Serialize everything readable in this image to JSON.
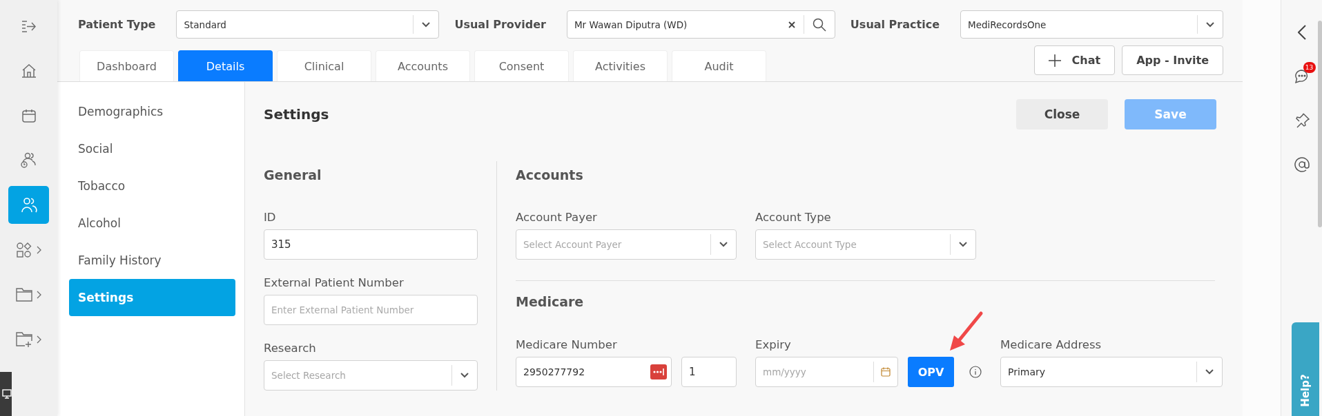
{
  "nav_rail": {
    "items": [
      {
        "kind": "expand",
        "selected": false,
        "submenu": false
      },
      {
        "kind": "home",
        "selected": false,
        "submenu": false
      },
      {
        "kind": "calendar",
        "selected": false,
        "submenu": false
      },
      {
        "kind": "waiting",
        "selected": false,
        "submenu": false
      },
      {
        "kind": "patients",
        "selected": true,
        "submenu": false
      },
      {
        "kind": "shapes",
        "selected": false,
        "submenu": true
      },
      {
        "kind": "folder",
        "selected": false,
        "submenu": true
      },
      {
        "kind": "folder-add",
        "selected": false,
        "submenu": true
      }
    ]
  },
  "header": {
    "fields": [
      {
        "label": "Patient Type",
        "value": "Standard",
        "kind": "select"
      },
      {
        "label": "Usual Provider",
        "value": "Mr Wawan Diputra (WD)",
        "kind": "search"
      },
      {
        "label": "Usual Practice",
        "value": "MediRecordsOne",
        "kind": "select"
      }
    ]
  },
  "tabs": [
    {
      "label": "Dashboard",
      "selected": false
    },
    {
      "label": "Details",
      "selected": true
    },
    {
      "label": "Clinical",
      "selected": false
    },
    {
      "label": "Accounts",
      "selected": false
    },
    {
      "label": "Consent",
      "selected": false
    },
    {
      "label": "Activities",
      "selected": false
    },
    {
      "label": "Audit",
      "selected": false
    }
  ],
  "header_buttons": [
    {
      "label": "Chat",
      "kind": "add"
    },
    {
      "label": "App - Invite",
      "kind": "plain"
    }
  ],
  "submenu": [
    {
      "label": "Demographics",
      "selected": false
    },
    {
      "label": "Social",
      "selected": false
    },
    {
      "label": "Tobacco",
      "selected": false
    },
    {
      "label": "Alcohol",
      "selected": false
    },
    {
      "label": "Family History",
      "selected": false
    },
    {
      "label": "Settings",
      "selected": true
    }
  ],
  "page": {
    "title": "Settings",
    "buttons": [
      {
        "label": "Close",
        "kind": "secondary",
        "disabled": false
      },
      {
        "label": "Save",
        "kind": "primary",
        "disabled": true
      }
    ]
  },
  "general": {
    "title": "General",
    "fields": [
      {
        "label": "ID",
        "value": "315",
        "kind": "text"
      },
      {
        "label": "External Patient Number",
        "placeholder": "Enter External Patient Number",
        "kind": "text"
      },
      {
        "label": "Research",
        "placeholder": "Select Research",
        "kind": "select"
      }
    ]
  },
  "accounts": {
    "title": "Accounts",
    "fields": [
      {
        "label": "Account Payer",
        "placeholder": "Select Account Payer"
      },
      {
        "label": "Account Type",
        "placeholder": "Select Account Type"
      }
    ]
  },
  "medicare": {
    "title": "Medicare",
    "number": {
      "label": "Medicare Number",
      "value": "2950277792",
      "irn": "1"
    },
    "expiry": {
      "label": "Expiry",
      "placeholder": "mm/yyyy"
    },
    "opv_button": "OPV",
    "address": {
      "label": "Medicare Address",
      "value": "Primary"
    }
  },
  "right_rail": {
    "items": [
      {
        "kind": "collapse"
      },
      {
        "kind": "chat",
        "badge": "13"
      },
      {
        "kind": "pin"
      },
      {
        "kind": "mention"
      }
    ]
  },
  "help_tab": "Help?"
}
